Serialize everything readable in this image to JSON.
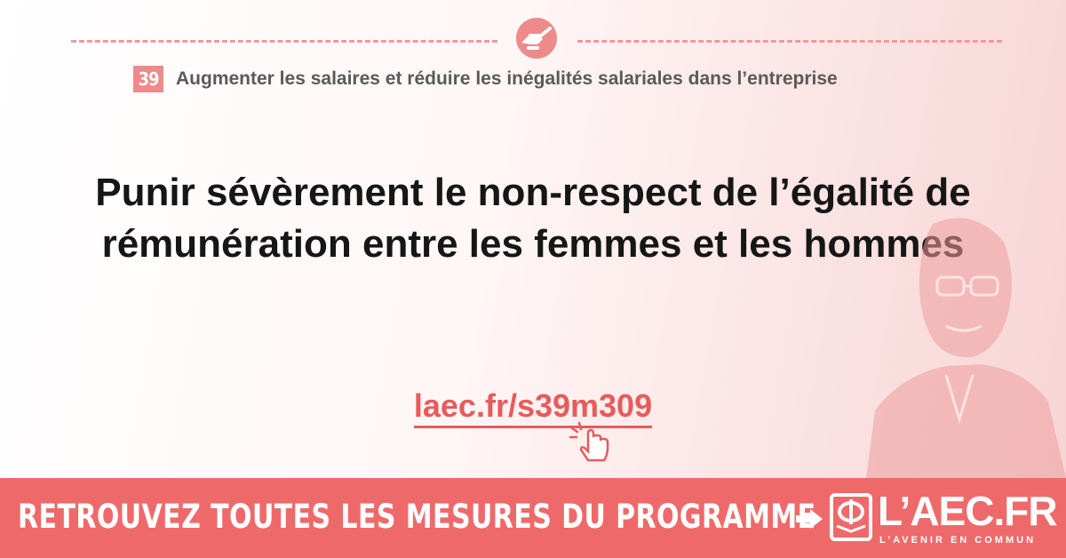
{
  "measure": {
    "number": "39",
    "title": "Augmenter les salaires et réduire les inégalités salariales dans l’entreprise"
  },
  "headline": "Punir sévèrement le non-respect de l’égalité de rémunération entre les femmes et les hommes",
  "short_link": "laec.fr/s39m309",
  "footer": {
    "cta": "RETROUVEZ TOUTES LES MESURES DU PROGRAMME",
    "brand": "L’AEC.FR",
    "tagline": "L’AVENIR EN COMMUN"
  },
  "icons": {
    "top": "handshake-icon",
    "link": "click-cursor-icon",
    "arrow": "arrow-right-icon",
    "logo": "phi-book-logo-icon"
  },
  "colors": {
    "accent": "#ee6a6a",
    "link": "#e85b5b",
    "dashes": "#ee9a9a"
  }
}
